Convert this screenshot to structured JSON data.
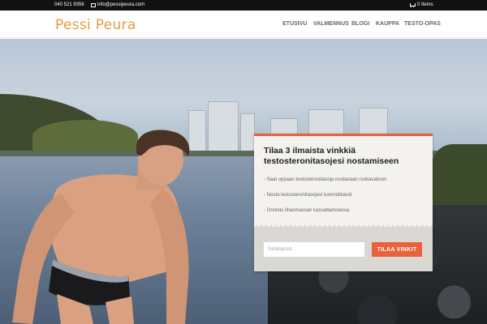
{
  "topbar": {
    "phone": "040 521 9356",
    "email": "info@pessipeura.com",
    "cart": "0 Items"
  },
  "header": {
    "logo": "Pessi Peura",
    "nav": [
      "ETUSIVU",
      "VALMENNUS",
      "BLOGI",
      "KAUPPA",
      "TESTO-OPAS"
    ]
  },
  "optin": {
    "title": "Tilaa 3 ilmaista vinkkiä testosteronitasojesi nostamiseen",
    "bullets": [
      "- Saat oppaan testosteronitasoja nostavaan ruokavalioon",
      "- Nosta testosteronitasojesi luonnollisesti",
      "- Onnistu lihasmassan kasvattamisessa"
    ],
    "email_placeholder": "Sähköposti",
    "button_label": "TILAA VINKIT"
  },
  "colors": {
    "accent": "#e8623d",
    "logo": "#e89b3b",
    "topbar": "#111111"
  },
  "icons": {
    "email": "envelope-icon",
    "cart": "cart-icon"
  }
}
